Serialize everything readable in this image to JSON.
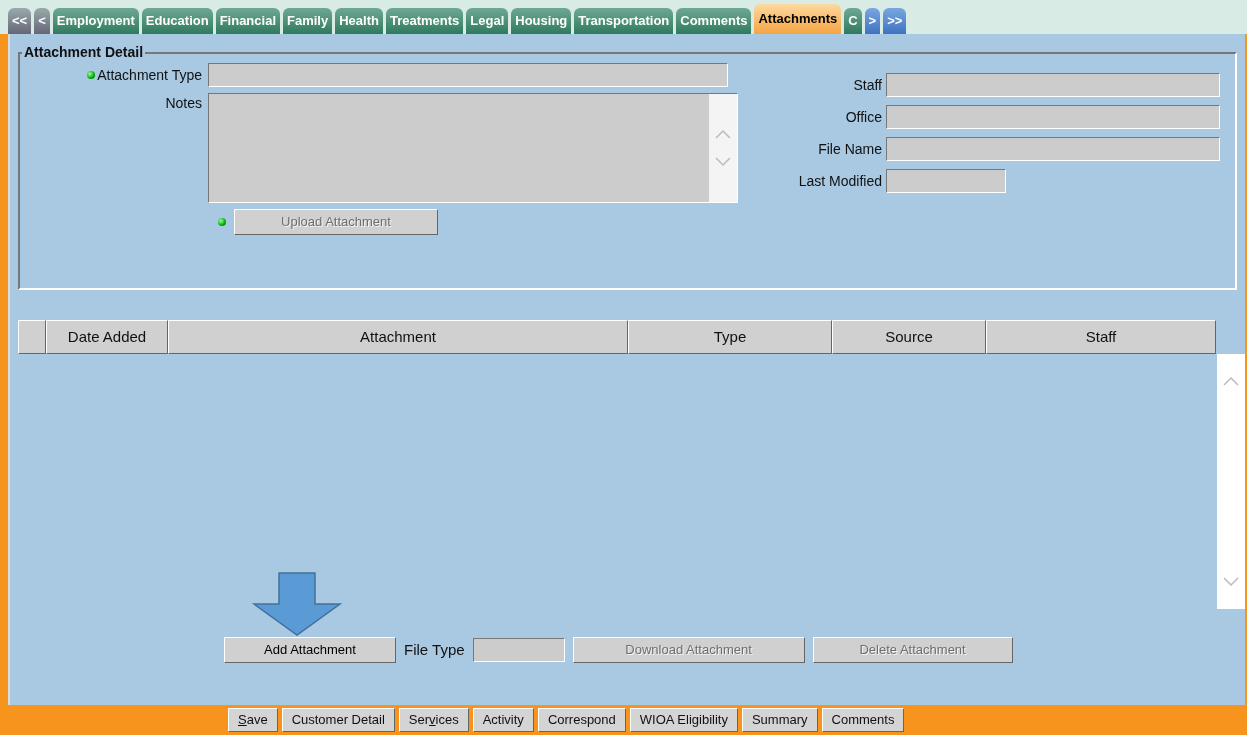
{
  "tabs": [
    {
      "label": "<<",
      "kind": "nav",
      "selected": false
    },
    {
      "label": "<",
      "kind": "nav",
      "selected": false
    },
    {
      "label": "Employment",
      "kind": "tab",
      "selected": false
    },
    {
      "label": "Education",
      "kind": "tab",
      "selected": false
    },
    {
      "label": "Financial",
      "kind": "tab",
      "selected": false
    },
    {
      "label": "Family",
      "kind": "tab",
      "selected": false
    },
    {
      "label": "Health",
      "kind": "tab",
      "selected": false
    },
    {
      "label": "Treatments",
      "kind": "tab",
      "selected": false
    },
    {
      "label": "Legal",
      "kind": "tab",
      "selected": false
    },
    {
      "label": "Housing",
      "kind": "tab",
      "selected": false
    },
    {
      "label": "Transportation",
      "kind": "tab",
      "selected": false
    },
    {
      "label": "Comments",
      "kind": "tab",
      "selected": false
    },
    {
      "label": "Attachments",
      "kind": "tab",
      "selected": true
    },
    {
      "label": "C",
      "kind": "tab",
      "selected": false
    },
    {
      "label": ">",
      "kind": "scroll",
      "selected": false
    },
    {
      "label": ">>",
      "kind": "scroll",
      "selected": false
    }
  ],
  "attachment_detail": {
    "title": "Attachment Detail",
    "attachment_type": {
      "label": "Attachment Type",
      "required": true
    },
    "notes": {
      "label": "Notes"
    },
    "upload_button": {
      "label": "Upload Attachment",
      "required": true,
      "disabled": true
    },
    "staff": {
      "label": "Staff"
    },
    "office": {
      "label": "Office"
    },
    "file_name": {
      "label": "File Name"
    },
    "last_modified": {
      "label": "Last Modified"
    }
  },
  "table": {
    "columns": [
      "",
      "Date Added",
      "Attachment",
      "Type",
      "Source",
      "Staff"
    ]
  },
  "actions": {
    "add_button": {
      "label": "Add Attachment",
      "disabled": false
    },
    "file_type": {
      "label": "File Type"
    },
    "download_button": {
      "label": "Download Attachment",
      "disabled": true
    },
    "delete_button": {
      "label": "Delete Attachment",
      "disabled": true
    }
  },
  "bottom_buttons": [
    {
      "label": {
        "key": "S",
        "after": "ave"
      }
    },
    {
      "label": "Customer Detail"
    },
    {
      "label": {
        "before": "Ser",
        "key": "v",
        "after": "ices"
      }
    },
    {
      "label": "Activity"
    },
    {
      "label": "Correspond"
    },
    {
      "label": "WIOA Eligibility"
    },
    {
      "label": "Summary"
    },
    {
      "label": "Comments"
    }
  ]
}
